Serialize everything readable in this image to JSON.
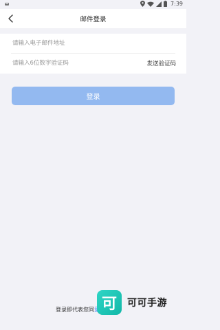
{
  "status_bar": {
    "time": "7:39"
  },
  "nav": {
    "title": "邮件登录"
  },
  "form": {
    "email_placeholder": "请输入电子邮件地址",
    "code_placeholder": "请输入6位数字验证码",
    "send_code_label": "发送验证码"
  },
  "login": {
    "button_label": "登录",
    "button_color": "#93b9f0"
  },
  "agreement": {
    "text": "登录即代表您同",
    "link_text": "意策"
  },
  "watermark": {
    "logo_char": "可",
    "text": "可可手游"
  },
  "colors": {
    "background": "#f2f2f7",
    "link": "#3d7ff5",
    "watermark": "#1fc6b6"
  },
  "icons": {
    "back": "chevron-left-icon",
    "location": "location-pin-icon",
    "wifi": "wifi-icon",
    "signal": "signal-icon",
    "battery": "battery-icon"
  }
}
